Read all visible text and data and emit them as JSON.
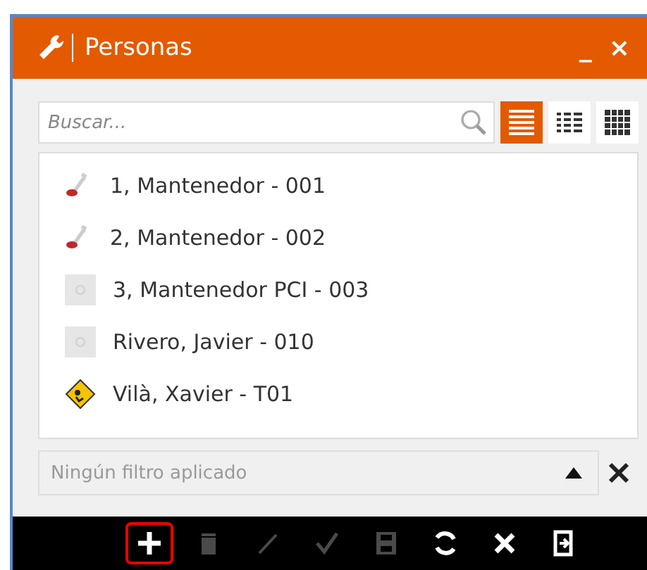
{
  "window": {
    "title": "Personas",
    "controls": [
      "_",
      "×"
    ]
  },
  "search": {
    "placeholder": "Buscar..."
  },
  "views": [
    {
      "kind": "list",
      "selected": true
    },
    {
      "kind": "details",
      "selected": false
    },
    {
      "kind": "grid",
      "selected": false
    }
  ],
  "items": [
    {
      "label": "1, Mantenedor - 001",
      "kind": "tool"
    },
    {
      "label": "2, Mantenedor - 002",
      "kind": "tool"
    },
    {
      "label": "3, Mantenedor PCI - 003",
      "kind": "photo"
    },
    {
      "label": "Rivero, Javier  - 010",
      "kind": "photo"
    },
    {
      "label": "Vilà, Xavier - T01",
      "kind": "sign"
    }
  ],
  "filter": {
    "placeholder": "Ningún filtro aplicado"
  },
  "toolbar": [
    {
      "kind": "add",
      "disabled": false,
      "highlighted": true
    },
    {
      "kind": "delete",
      "disabled": true,
      "highlighted": false
    },
    {
      "kind": "edit",
      "disabled": true,
      "highlighted": false
    },
    {
      "kind": "confirm",
      "disabled": true,
      "highlighted": false
    },
    {
      "kind": "save",
      "disabled": true,
      "highlighted": false
    },
    {
      "kind": "refresh",
      "disabled": false,
      "highlighted": false
    },
    {
      "kind": "cancel",
      "disabled": false,
      "highlighted": false
    },
    {
      "kind": "exit",
      "disabled": false,
      "highlighted": false
    }
  ]
}
